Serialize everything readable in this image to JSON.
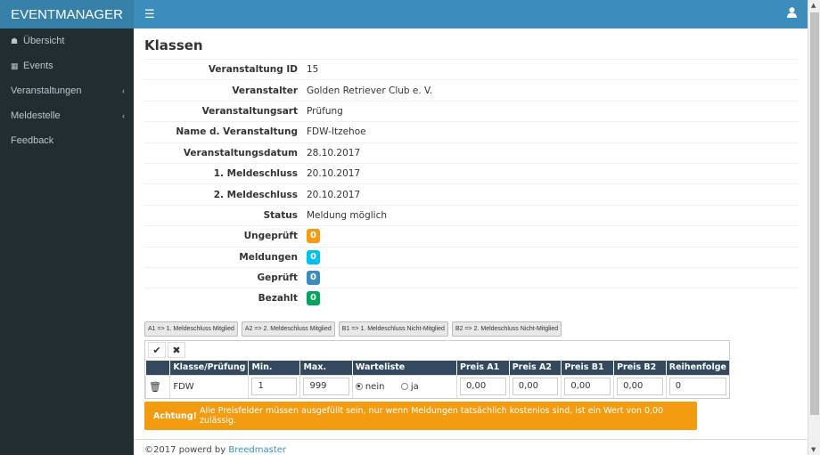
{
  "header": {
    "logo": "EVENTMANAGER",
    "menu_icon": "bars-icon",
    "user_icon": "user-icon"
  },
  "sidebar": {
    "items": [
      {
        "label": "Übersicht",
        "icon": "home-icon"
      },
      {
        "label": "Events",
        "icon": "calendar-icon"
      },
      {
        "label": "Veranstaltungen",
        "expandable": true
      },
      {
        "label": "Meldestelle",
        "expandable": true
      },
      {
        "label": "Feedback"
      }
    ]
  },
  "page": {
    "title": "Klassen"
  },
  "details": [
    {
      "label": "Veranstaltung ID",
      "value": "15"
    },
    {
      "label": "Veranstalter",
      "value": "Golden Retriever Club e. V."
    },
    {
      "label": "Veranstaltungsart",
      "value": "Prüfung"
    },
    {
      "label": "Name d. Veranstaltung",
      "value": "FDW-Itzehoe"
    },
    {
      "label": "Veranstaltungsdatum",
      "value": "28.10.2017"
    },
    {
      "label": "1. Meldeschluss",
      "value": "20.10.2017"
    },
    {
      "label": "2. Meldeschluss",
      "value": "20.10.2017"
    },
    {
      "label": "Status",
      "value": "Meldung möglich"
    },
    {
      "label": "Ungeprüft",
      "value": "0",
      "color": "#f39c12"
    },
    {
      "label": "Meldungen",
      "value": "0",
      "color": "#00c0ef"
    },
    {
      "label": "Geprüft",
      "value": "0",
      "color": "#3c8dbc"
    },
    {
      "label": "Bezahlt",
      "value": "0",
      "color": "#00a65a"
    }
  ],
  "legend": [
    "A1 => 1. Meldeschluss Mitglied",
    "A2 => 2. Meldeschluss Mitglied",
    "B1 => 1. Meldeschluss Nicht-Mitglied",
    "B2 => 2. Meldeschluss Nicht-Mitglied"
  ],
  "toolbar": {
    "confirm_icon": "check-icon",
    "cancel_icon": "x-icon"
  },
  "table": {
    "columns": [
      "",
      "Klasse/Prüfung",
      "Min.",
      "Max.",
      "Warteliste",
      "Preis A1",
      "Preis A2",
      "Preis B1",
      "Preis B2",
      "Reihenfolge"
    ],
    "row": {
      "delete_icon": "trash-icon",
      "klasse": "FDW",
      "min": "1",
      "max": "999",
      "warteliste_options": [
        "nein",
        "ja"
      ],
      "warteliste_selected": "nein",
      "preis_a1": "0,00",
      "preis_a2": "0,00",
      "preis_b1": "0,00",
      "preis_b2": "0,00",
      "reihenfolge": "0"
    }
  },
  "alert": {
    "strong": "Achtung!",
    "text": "Alle Preisfelder müssen ausgefüllt sein, nur wenn Meldungen tatsächlich kostenlos sind, ist ein Wert von 0,00 zulässig."
  },
  "footer": {
    "text": "©2017 powerd by",
    "link": "Breedmaster"
  }
}
